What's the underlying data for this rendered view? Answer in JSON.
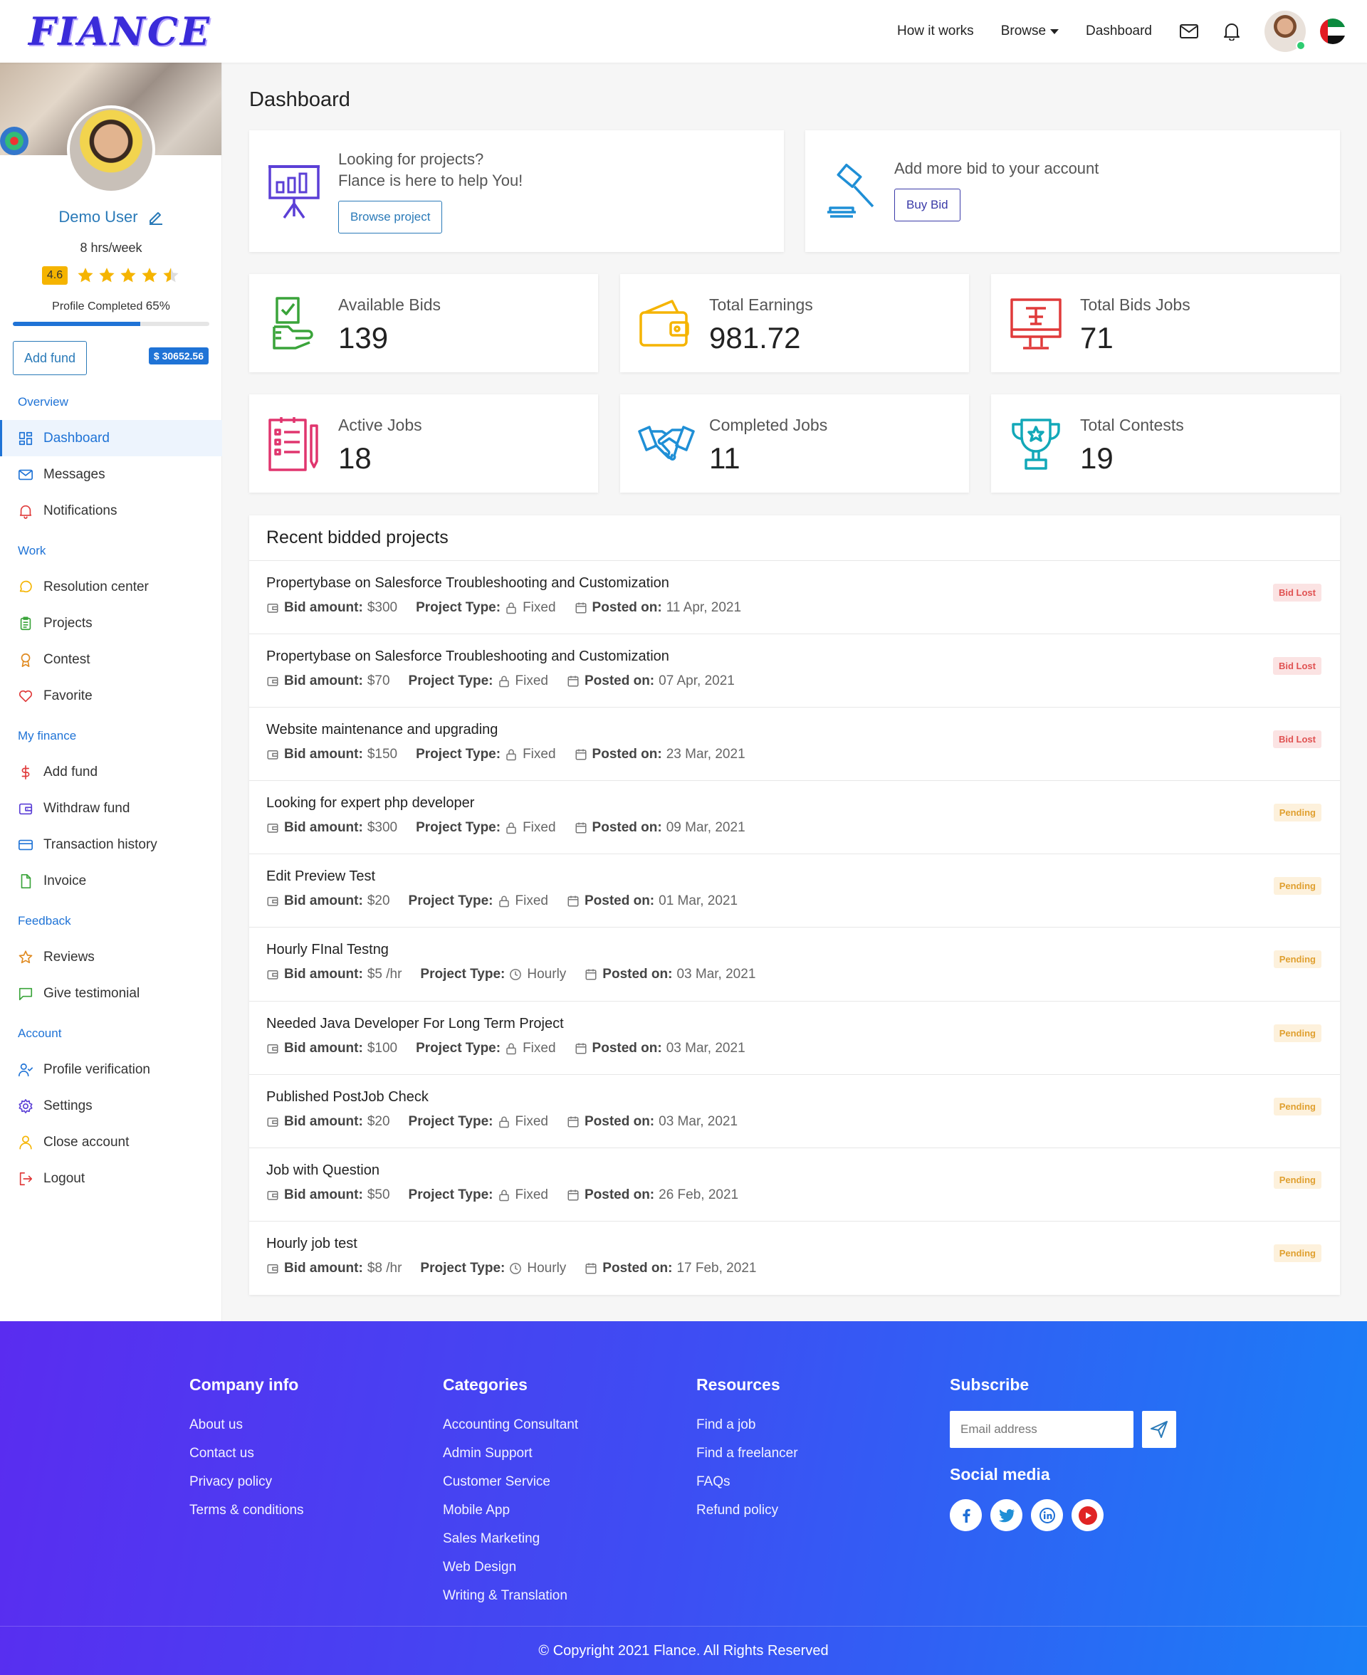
{
  "header": {
    "logo": "FIANCE",
    "nav": {
      "how_it_works": "How it works",
      "browse": "Browse",
      "dashboard": "Dashboard"
    }
  },
  "sidebar": {
    "user_name": "Demo User",
    "hours": "8 hrs/week",
    "rating": "4.6",
    "stars": 4.5,
    "profile_completed_label": "Profile Completed",
    "profile_completed_value": "65%",
    "profile_completed_fraction": 0.65,
    "add_fund_button": "Add fund",
    "balance": "$ 30652.56",
    "sections": [
      {
        "title": "Overview",
        "items": [
          {
            "label": "Dashboard",
            "icon": "dashboard-icon",
            "active": true
          },
          {
            "label": "Messages",
            "icon": "mail-icon"
          },
          {
            "label": "Notifications",
            "icon": "bell-icon"
          }
        ]
      },
      {
        "title": "Work",
        "items": [
          {
            "label": "Resolution center",
            "icon": "chat-bubble-icon"
          },
          {
            "label": "Projects",
            "icon": "clipboard-icon"
          },
          {
            "label": "Contest",
            "icon": "award-icon"
          },
          {
            "label": "Favorite",
            "icon": "heart-icon"
          }
        ]
      },
      {
        "title": "My finance",
        "items": [
          {
            "label": "Add fund",
            "icon": "dollar-icon"
          },
          {
            "label": "Withdraw fund",
            "icon": "wallet-icon"
          },
          {
            "label": "Transaction history",
            "icon": "credit-card-icon"
          },
          {
            "label": "Invoice",
            "icon": "file-icon"
          }
        ]
      },
      {
        "title": "Feedback",
        "items": [
          {
            "label": "Reviews",
            "icon": "star-icon"
          },
          {
            "label": "Give testimonial",
            "icon": "message-square-icon"
          }
        ]
      },
      {
        "title": "Account",
        "items": [
          {
            "label": "Profile verification",
            "icon": "user-check-icon"
          },
          {
            "label": "Settings",
            "icon": "gear-icon"
          },
          {
            "label": "Close account",
            "icon": "user-icon"
          },
          {
            "label": "Logout",
            "icon": "logout-icon"
          }
        ]
      }
    ]
  },
  "main": {
    "title": "Dashboard",
    "promo_projects": {
      "line1": "Looking for projects?",
      "line2": "Flance is here to help You!",
      "button": "Browse project"
    },
    "promo_bid": {
      "text": "Add more bid to your account",
      "button": "Buy Bid"
    },
    "stats": [
      {
        "label": "Available Bids",
        "value": "139",
        "icon": "bid-hand-icon",
        "color": "#3aa43a"
      },
      {
        "label": "Total Earnings",
        "value": "981.72",
        "icon": "wallet-icon",
        "color": "#f5b400"
      },
      {
        "label": "Total Bids Jobs",
        "value": "71",
        "icon": "monitor-icon",
        "color": "#e03a3a"
      },
      {
        "label": "Active Jobs",
        "value": "18",
        "icon": "document-list-icon",
        "color": "#e0356e"
      },
      {
        "label": "Completed Jobs",
        "value": "11",
        "icon": "handshake-icon",
        "color": "#1f8fd6"
      },
      {
        "label": "Total Contests",
        "value": "19",
        "icon": "trophy-icon",
        "color": "#12a8b8"
      }
    ],
    "recent": {
      "title": "Recent bidded projects",
      "labels": {
        "bid_amount": "Bid amount:",
        "project_type": "Project Type:",
        "posted_on": "Posted on:"
      },
      "projects": [
        {
          "title": "Propertybase on Salesforce Troubleshooting and Customization",
          "bid": "$300",
          "type": "Fixed",
          "posted": "11 Apr, 2021",
          "status": "Bid Lost"
        },
        {
          "title": "Propertybase on Salesforce Troubleshooting and Customization",
          "bid": "$70",
          "type": "Fixed",
          "posted": "07 Apr, 2021",
          "status": "Bid Lost"
        },
        {
          "title": "Website maintenance and upgrading",
          "bid": "$150",
          "type": "Fixed",
          "posted": "23 Mar, 2021",
          "status": "Bid Lost"
        },
        {
          "title": "Looking for expert php developer",
          "bid": "$300",
          "type": "Fixed",
          "posted": "09 Mar, 2021",
          "status": "Pending"
        },
        {
          "title": "Edit Preview Test",
          "bid": "$20",
          "type": "Fixed",
          "posted": "01 Mar, 2021",
          "status": "Pending"
        },
        {
          "title": "Hourly FInal Testng",
          "bid": "$5 /hr",
          "type": "Hourly",
          "posted": "03 Mar, 2021",
          "status": "Pending"
        },
        {
          "title": "Needed Java Developer For Long Term Project",
          "bid": "$100",
          "type": "Fixed",
          "posted": "03 Mar, 2021",
          "status": "Pending"
        },
        {
          "title": "Published PostJob Check",
          "bid": "$20",
          "type": "Fixed",
          "posted": "03 Mar, 2021",
          "status": "Pending"
        },
        {
          "title": "Job with Question",
          "bid": "$50",
          "type": "Fixed",
          "posted": "26 Feb, 2021",
          "status": "Pending"
        },
        {
          "title": "Hourly job test",
          "bid": "$8 /hr",
          "type": "Hourly",
          "posted": "17 Feb, 2021",
          "status": "Pending"
        }
      ]
    }
  },
  "footer": {
    "company": {
      "title": "Company info",
      "links": [
        "About us",
        "Contact us",
        "Privacy policy",
        "Terms & conditions"
      ]
    },
    "categories": {
      "title": "Categories",
      "links": [
        "Accounting Consultant",
        "Admin Support",
        "Customer Service",
        "Mobile App",
        "Sales Marketing",
        "Web Design",
        "Writing & Translation"
      ]
    },
    "resources": {
      "title": "Resources",
      "links": [
        "Find a job",
        "Find a freelancer",
        "FAQs",
        "Refund policy"
      ]
    },
    "subscribe": {
      "title": "Subscribe",
      "placeholder": "Email address"
    },
    "social": {
      "title": "Social media",
      "items": [
        "facebook-icon",
        "twitter-icon",
        "linkedin-icon",
        "youtube-icon"
      ]
    },
    "copyright": "© Copyright 2021 Flance. All Rights Reserved"
  }
}
